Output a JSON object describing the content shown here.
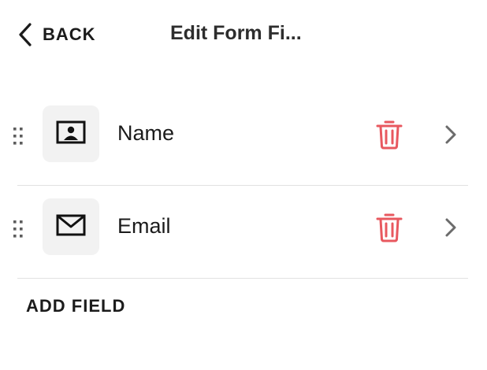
{
  "header": {
    "back_label": "BACK",
    "title": "Edit Form Fi..."
  },
  "fields": [
    {
      "label": "Name",
      "icon": "contact-card-icon"
    },
    {
      "label": "Email",
      "icon": "envelope-icon"
    }
  ],
  "add_field_label": "ADD FIELD",
  "colors": {
    "text": "#1b1b1b",
    "delete": "#e8585f",
    "chevron": "#6b6b6b",
    "icon_box_bg": "#f2f2f2",
    "divider": "#e1e1e1"
  }
}
